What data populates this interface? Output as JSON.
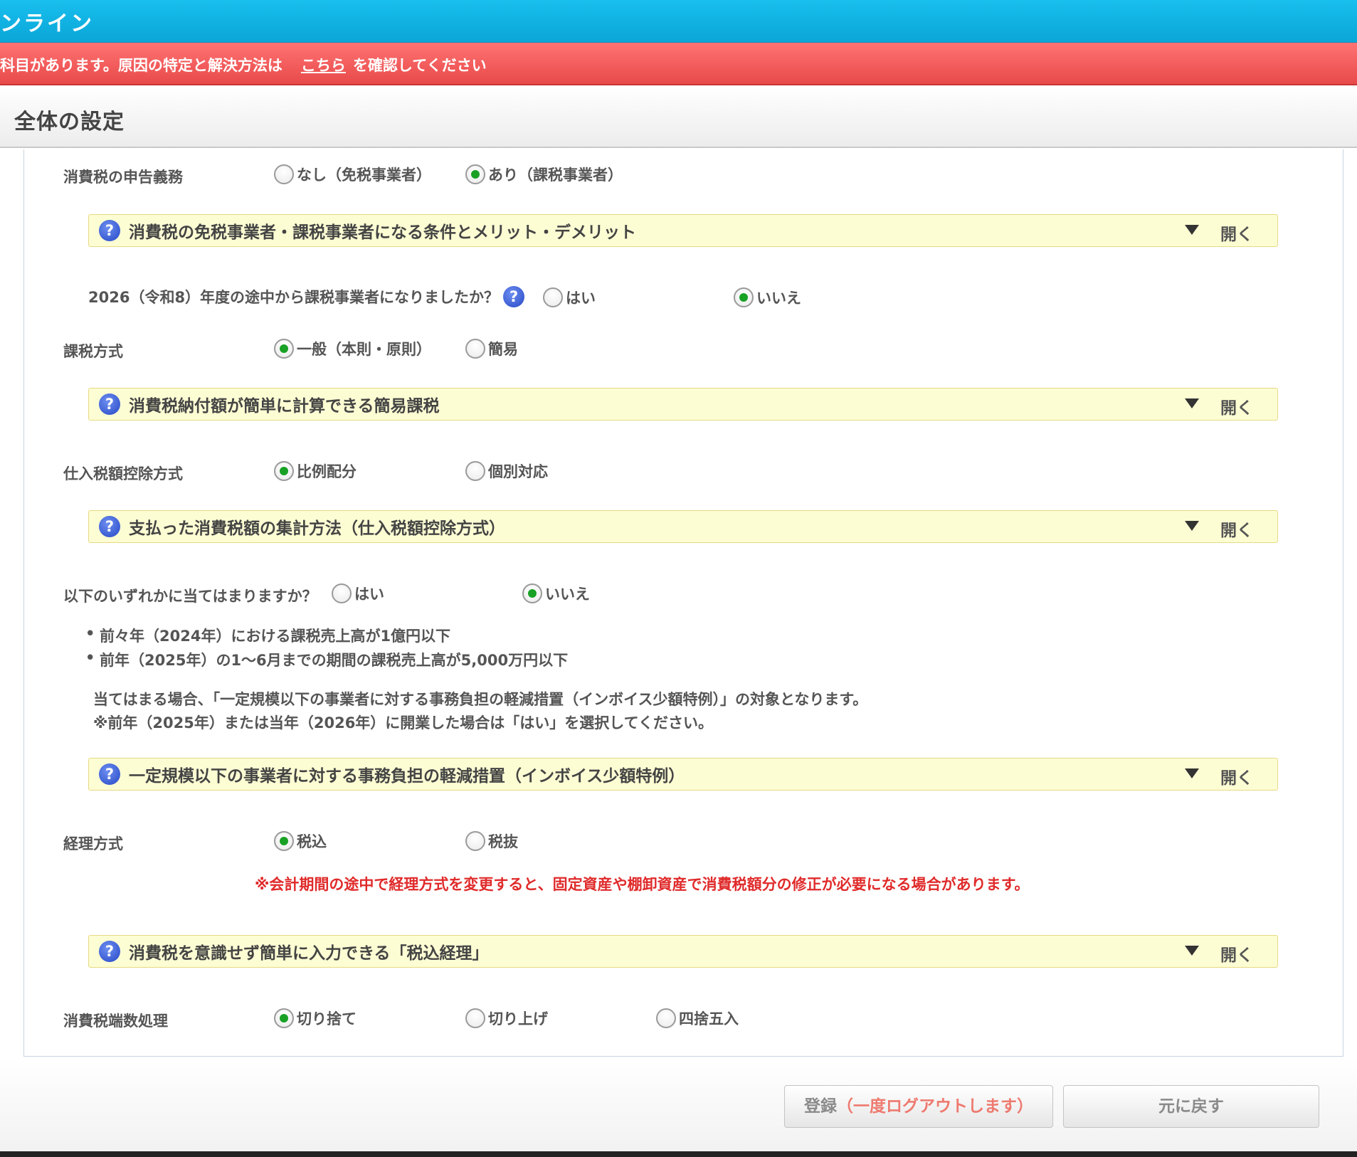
{
  "header": {
    "title": "ンライン"
  },
  "alert": {
    "prefix": "科目があります。原因の特定と解決方法は",
    "link": "こちら",
    "suffix": "を確認してください"
  },
  "section": {
    "title": "全体の設定"
  },
  "form": {
    "filing": {
      "label": "消費税の申告義務",
      "options": [
        "なし（免税事業者）",
        "あり（課税事業者）"
      ],
      "selected": "あり（課税事業者）"
    },
    "acc1": {
      "title": "消費税の免税事業者・課税事業者になる条件とメリット・デメリット",
      "action": "開く"
    },
    "midyear": {
      "label": "2026（令和8）年度の途中から課税事業者になりましたか？",
      "options": [
        "はい",
        "いいえ"
      ],
      "selected": "いいえ"
    },
    "method": {
      "label": "課税方式",
      "options": [
        "一般（本則・原則）",
        "簡易"
      ],
      "selected": "一般（本則・原則）"
    },
    "acc2": {
      "title": "消費税納付額が簡単に計算できる簡易課税",
      "action": "開く"
    },
    "deduction": {
      "label": "仕入税額控除方式",
      "options": [
        "比例配分",
        "個別対応"
      ],
      "selected": "比例配分"
    },
    "acc3": {
      "title": "支払った消費税額の集計方法（仕入税額控除方式）",
      "action": "開く"
    },
    "smallbiz": {
      "label": "以下のいずれかに当てはまりますか？",
      "options": [
        "はい",
        "いいえ"
      ],
      "selected": "いいえ",
      "bullets": [
        "前々年（2024年）における課税売上高が1億円以下",
        "前年（2025年）の1〜6月までの期間の課税売上高が5,000万円以下"
      ],
      "note1": "当てはまる場合、「一定規模以下の事業者に対する事務負担の軽減措置（インボイス少額特例）」の対象となります。",
      "note2": "※前年（2025年）または当年（2026年）に開業した場合は「はい」を選択してください。"
    },
    "acc4": {
      "title": "一定規模以下の事業者に対する事務負担の軽減措置（インボイス少額特例）",
      "action": "開く"
    },
    "accounting": {
      "label": "経理方式",
      "options": [
        "税込",
        "税抜"
      ],
      "selected": "税込",
      "warning": "※会計期間の途中で経理方式を変更すると、固定資産や棚卸資産で消費税額分の修正が必要になる場合があります。"
    },
    "acc5": {
      "title": "消費税を意識せず簡単に入力できる「税込経理」",
      "action": "開く"
    },
    "rounding": {
      "label": "消費税端数処理",
      "options": [
        "切り捨て",
        "切り上げ",
        "四捨五入"
      ],
      "selected": "切り捨て"
    }
  },
  "footer": {
    "register_label": "登録",
    "register_note": "（一度ログアウトします）",
    "revert_label": "元に戻す"
  },
  "colors": {
    "topbar": "#0aa6d8",
    "alert": "#e84a4a",
    "accordion_bg": "#fdfdd4",
    "radio_on": "#19a125",
    "warning_text": "#e02a2a"
  },
  "icons": [
    "help-icon",
    "triangle-down-icon",
    "radio-icon"
  ]
}
